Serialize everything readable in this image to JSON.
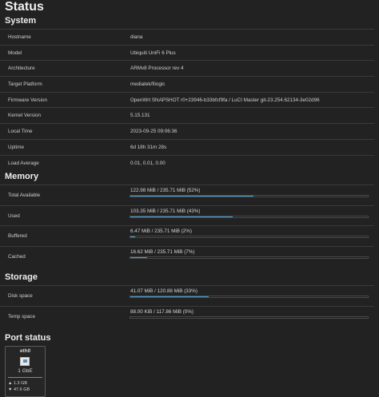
{
  "page_title": "Status",
  "system": {
    "heading": "System",
    "rows": [
      {
        "key": "Hostname",
        "value": "diana"
      },
      {
        "key": "Model",
        "value": "Ubiquiti UniFi 6 Plus"
      },
      {
        "key": "Architecture",
        "value": "ARMv8 Processor rev 4"
      },
      {
        "key": "Target Platform",
        "value": "mediatek/filogic"
      },
      {
        "key": "Firmware Version",
        "value": "OpenWrt SNAPSHOT r0+23946-b33bfcf9fa / LuCI Master git-23.254.62134-3e02d96"
      },
      {
        "key": "Kernel Version",
        "value": "5.15.131"
      },
      {
        "key": "Local Time",
        "value": "2023-09-25 09:06:36"
      },
      {
        "key": "Uptime",
        "value": "6d 18h 31m 28s"
      },
      {
        "key": "Load Average",
        "value": "0.01, 0.01, 0.00"
      }
    ]
  },
  "memory": {
    "heading": "Memory",
    "rows": [
      {
        "key": "Total Available",
        "label": "122.98 MiB / 235.71 MiB (52%)",
        "percent": 52
      },
      {
        "key": "Used",
        "label": "103.35 MiB / 235.71 MiB (43%)",
        "percent": 43
      },
      {
        "key": "Buffered",
        "label": "6.47 MiB / 235.71 MiB (2%)",
        "percent": 2
      },
      {
        "key": "Cached",
        "label": "16.62 MiB / 235.71 MiB (7%)",
        "percent": 7
      }
    ]
  },
  "storage": {
    "heading": "Storage",
    "rows": [
      {
        "key": "Disk space",
        "label": "41.07 MiB / 120.88 MiB (33%)",
        "percent": 33
      },
      {
        "key": "Temp space",
        "label": "88.00 KiB / 117.86 MiB (0%)",
        "percent": 0
      }
    ]
  },
  "port_status": {
    "heading": "Port status",
    "ports": [
      {
        "name": "eth0",
        "speed": "1 GbE",
        "tx": "▲ 1.3 GB",
        "rx": "▼ 47.6 GB",
        "icon": "ethernet-port-icon",
        "link_color": "#5aa848"
      }
    ]
  },
  "colors": {
    "background": "#222222",
    "bar_fill": "#4a9ac9"
  }
}
